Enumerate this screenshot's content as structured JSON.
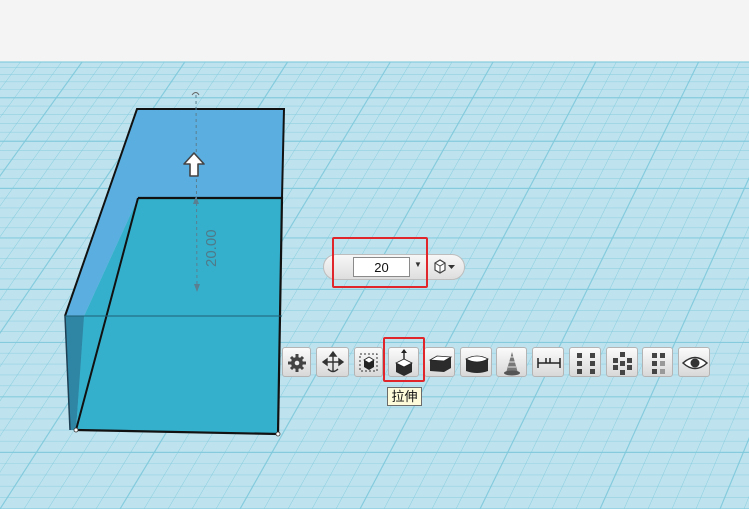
{
  "dimension_label": "20.00",
  "extrude_popup": {
    "value": "20"
  },
  "toolbar": {
    "tools": [
      {
        "name": "settings-tool-button",
        "icon": "gear-icon"
      },
      {
        "name": "move-tool-button",
        "icon": "move-arrows-icon"
      },
      {
        "name": "select-tool-button",
        "icon": "select-box-icon"
      },
      {
        "name": "extrude-tool-button",
        "icon": "extrude-icon"
      },
      {
        "name": "shell-tool-button",
        "icon": "shell-icon"
      },
      {
        "name": "fillet-tool-button",
        "icon": "fillet-icon"
      },
      {
        "name": "twist-tool-button",
        "icon": "twist-icon"
      },
      {
        "name": "measure-tool-button",
        "icon": "measure-icon"
      },
      {
        "name": "grid-pattern-tool-button",
        "icon": "grid-pattern-icon"
      },
      {
        "name": "circular-pattern-tool-button",
        "icon": "circular-pattern-icon"
      },
      {
        "name": "linear-pattern-tool-button",
        "icon": "linear-pattern-icon"
      },
      {
        "name": "visibility-tool-button",
        "icon": "eye-icon"
      }
    ],
    "tooltip": "拉伸"
  },
  "colors": {
    "grid_background": "#bfe3ee",
    "grid_line": "#7fc9dc",
    "box_top_face": "#5aaee0",
    "box_front_face": "#35b0cc",
    "box_side_face": "#2f86a4",
    "highlight": "#e0262b"
  }
}
